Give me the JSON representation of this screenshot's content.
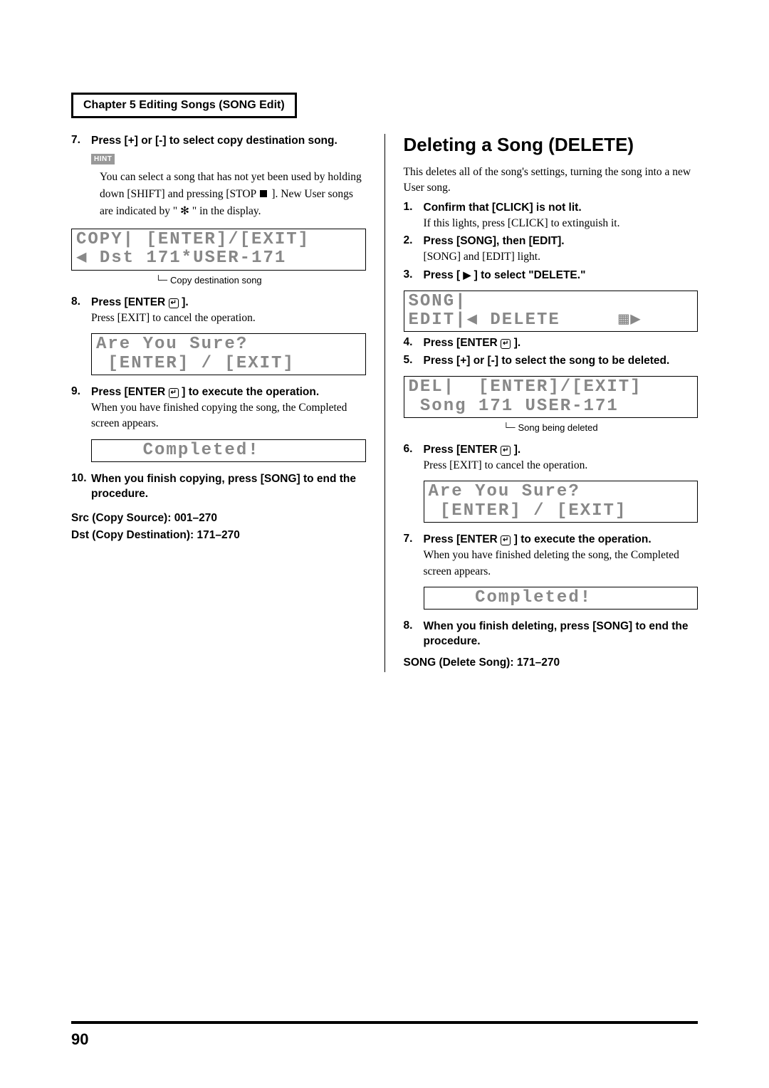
{
  "chapterHeader": "Chapter 5 Editing Songs (SONG Edit)",
  "pageNumber": "90",
  "left": {
    "step7": {
      "num": "7.",
      "bold": "Press [+] or [-] to select copy destination song."
    },
    "hintLabel": "HINT",
    "hintText_a": "You can select a song that has not yet been used by holding down [SHIFT] and pressing [STOP ",
    "hintText_b": " ]. New User songs are indicated by \" ✻ \" in the display.",
    "lcd1": {
      "line1": "COPY| [ENTER]/[EXIT]",
      "line2": "◀ Dst 171*USER-171"
    },
    "lcd1Caption": "Copy destination song",
    "step8": {
      "num": "8.",
      "bold_a": "Press [ENTER ",
      "bold_b": " ].",
      "plain": "Press [EXIT] to cancel the operation."
    },
    "lcd2": {
      "line1": "Are You Sure?",
      "line2": " [ENTER] / [EXIT]"
    },
    "step9": {
      "num": "9.",
      "bold_a": "Press [ENTER ",
      "bold_b": " ] to execute the operation.",
      "plain": "When you have finished copying the song, the Completed screen appears."
    },
    "lcd3": {
      "line1": "",
      "line2": "    Completed!"
    },
    "step10": {
      "num": "10.",
      "bold": "When you finish copying, press [SONG] to end the procedure."
    },
    "srcLine": "Src (Copy Source): 001–270",
    "dstLine": "Dst (Copy Destination): 171–270"
  },
  "right": {
    "title": "Deleting a Song (DELETE)",
    "intro": "This deletes all of the song's settings, turning the song into a new User song.",
    "step1": {
      "num": "1.",
      "bold": "Confirm that [CLICK] is not lit.",
      "plain": "If this lights, press [CLICK] to extinguish it."
    },
    "step2": {
      "num": "2.",
      "bold": "Press [SONG], then [EDIT].",
      "plain": "[SONG] and [EDIT] light."
    },
    "step3": {
      "num": "3.",
      "bold_a": "Press [ ",
      "bold_b": " ] to select \"DELETE.\""
    },
    "lcd1": {
      "line1": "SONG|",
      "line2": "EDIT|◀ DELETE     ▦▶"
    },
    "step4": {
      "num": "4.",
      "bold_a": "Press [ENTER ",
      "bold_b": " ]."
    },
    "step5": {
      "num": "5.",
      "bold": "Press [+] or [-] to select the song to be deleted."
    },
    "lcd2": {
      "line1": "DEL|  [ENTER]/[EXIT]",
      "line2": " Song 171 USER-171"
    },
    "lcd2Caption": "Song being deleted",
    "step6": {
      "num": "6.",
      "bold_a": "Press [ENTER ",
      "bold_b": " ].",
      "plain": "Press [EXIT] to cancel the operation."
    },
    "lcd3": {
      "line1": "Are You Sure?",
      "line2": " [ENTER] / [EXIT]"
    },
    "step7": {
      "num": "7.",
      "bold_a": "Press [ENTER ",
      "bold_b": " ] to execute the operation.",
      "plain": "When you have finished deleting the song, the Completed screen appears."
    },
    "lcd4": {
      "line1": "",
      "line2": "    Completed!"
    },
    "step8": {
      "num": "8.",
      "bold": "When you finish deleting, press [SONG] to end the procedure."
    },
    "rangeLine": "SONG (Delete Song): 171–270"
  }
}
